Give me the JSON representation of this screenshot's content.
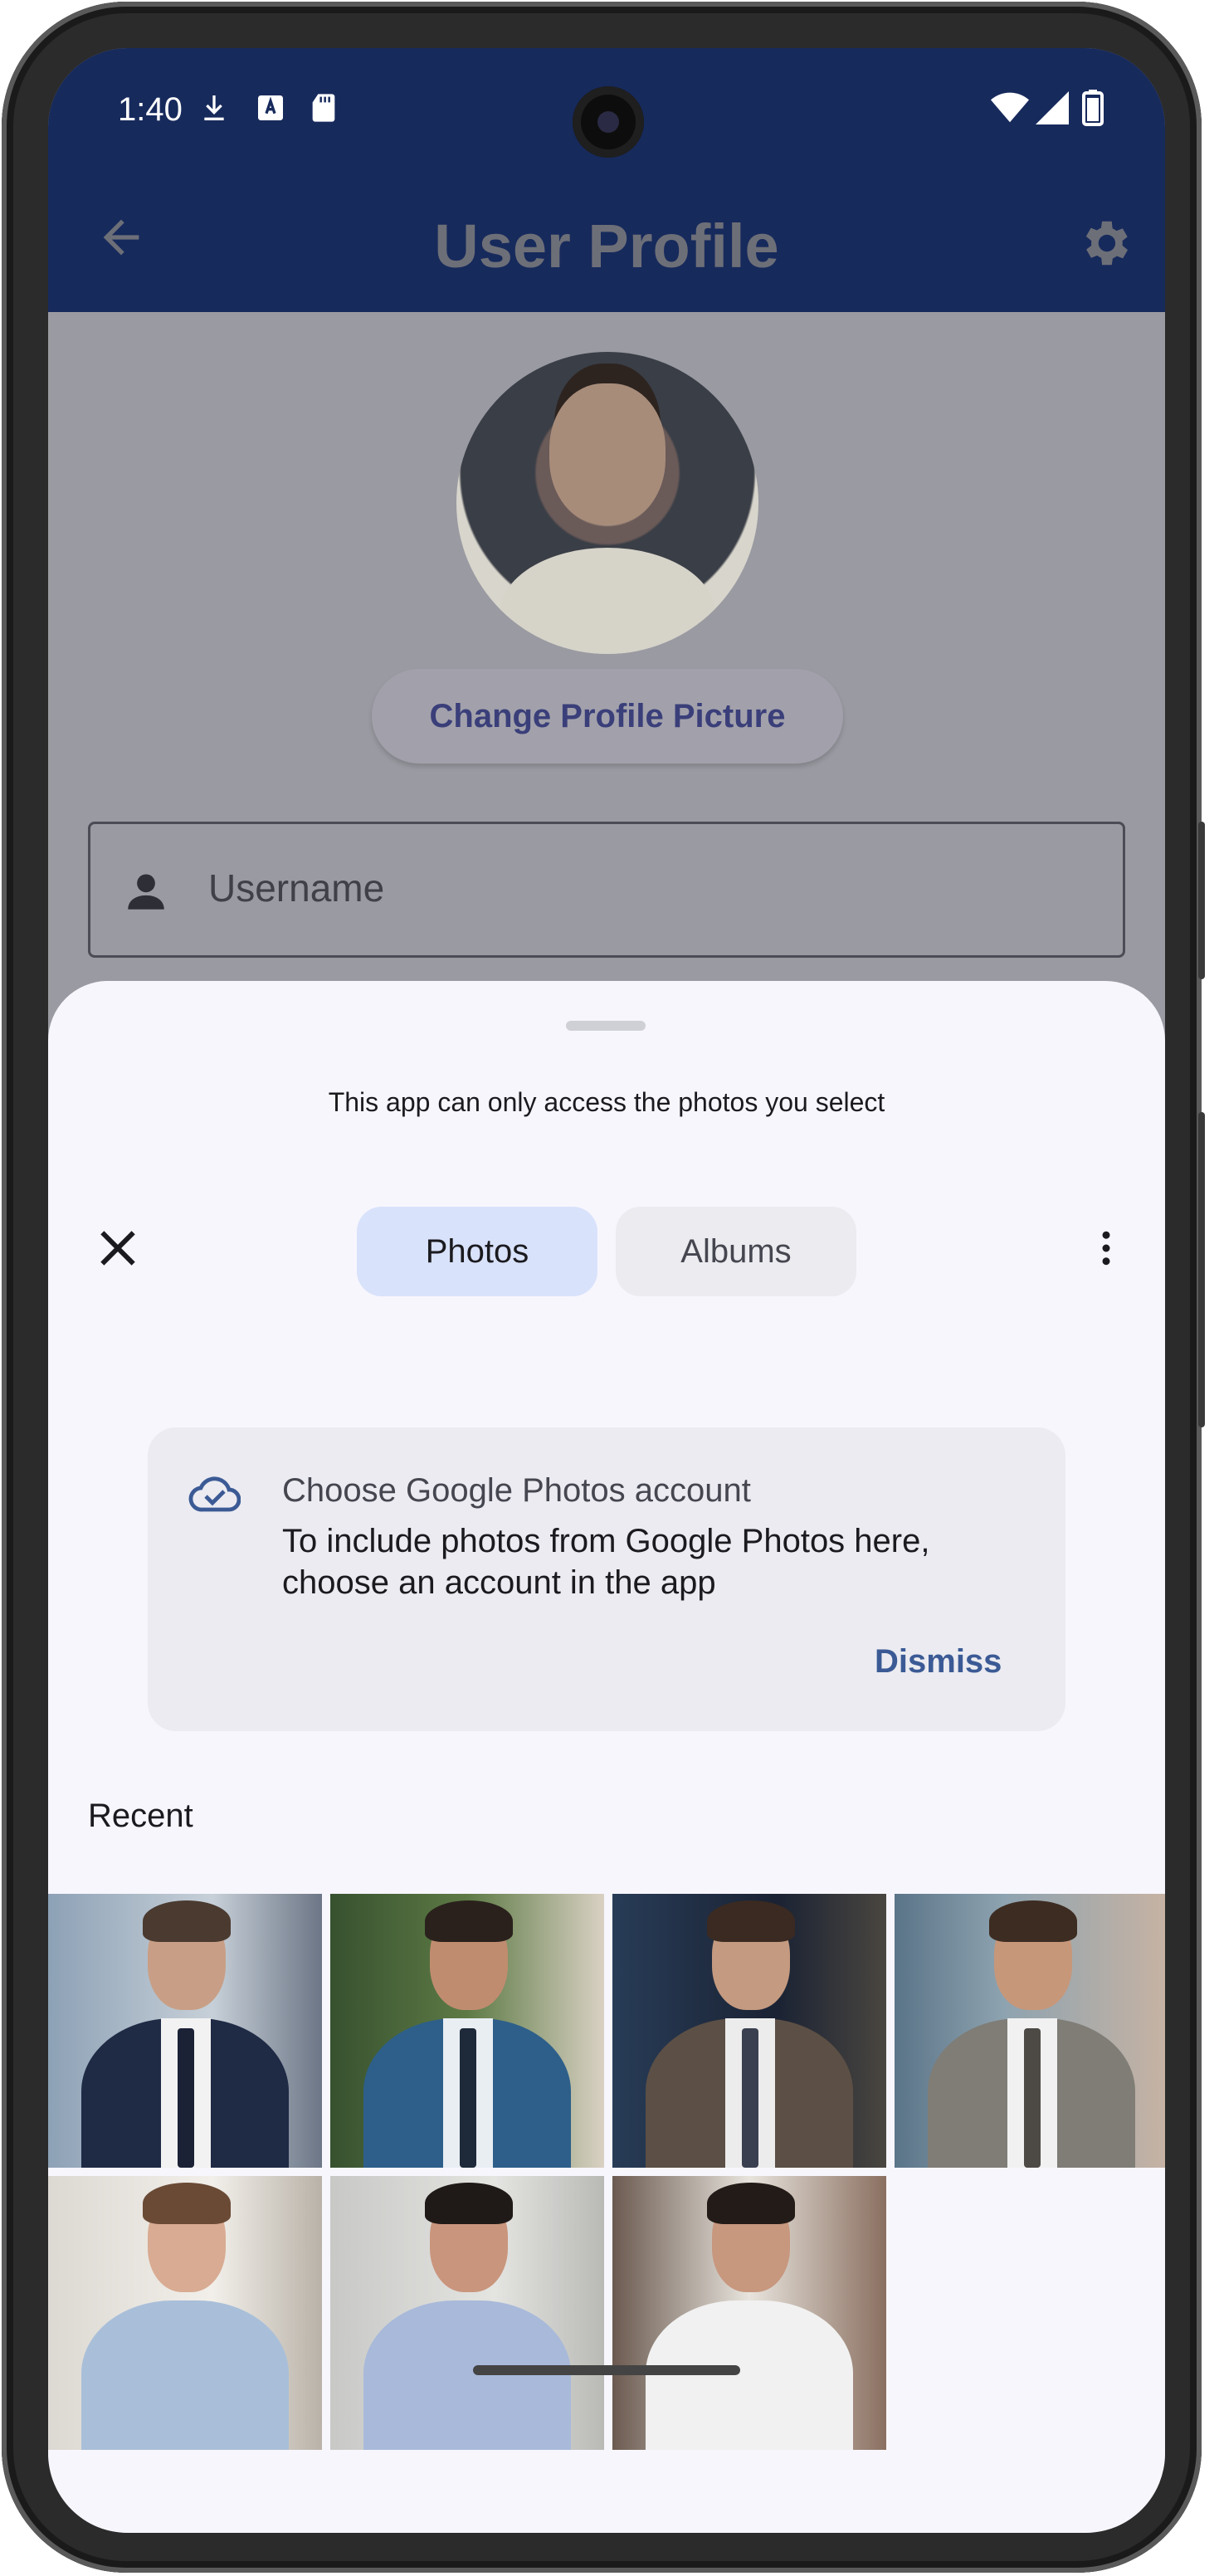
{
  "status_bar": {
    "time": "1:40",
    "left_icons": [
      "download-icon",
      "font-icon",
      "sd-card-icon"
    ],
    "right_icons": [
      "wifi-icon",
      "signal-icon",
      "battery-icon"
    ]
  },
  "app_bar": {
    "title": "User Profile",
    "back_icon": "arrow-back-icon",
    "settings_icon": "gear-icon"
  },
  "profile": {
    "change_picture_label": "Change Profile Picture",
    "username_placeholder": "Username"
  },
  "picker": {
    "notice": "This app can only access the photos you select",
    "tabs": [
      {
        "label": "Photos",
        "selected": true
      },
      {
        "label": "Albums",
        "selected": false
      }
    ],
    "card": {
      "title": "Choose Google Photos account",
      "body": "To include photos from Google Photos here, choose an account in the app",
      "dismiss_label": "Dismiss"
    },
    "section_label": "Recent",
    "photos": [
      {
        "name": "photo-man-navy-suit-city"
      },
      {
        "name": "photo-man-blue-suit-hedge"
      },
      {
        "name": "photo-man-brown-suit-office"
      },
      {
        "name": "photo-man-gray-suit-windows"
      },
      {
        "name": "photo-man-blue-shirt"
      },
      {
        "name": "photo-woman-blue-shirt"
      },
      {
        "name": "photo-woman-white-shirt"
      }
    ]
  },
  "colors": {
    "app_bar": "#172a5c",
    "sheet_bg": "#f7f6fd",
    "tab_selected": "#d9e2fb",
    "accent": "#3b5a95"
  }
}
